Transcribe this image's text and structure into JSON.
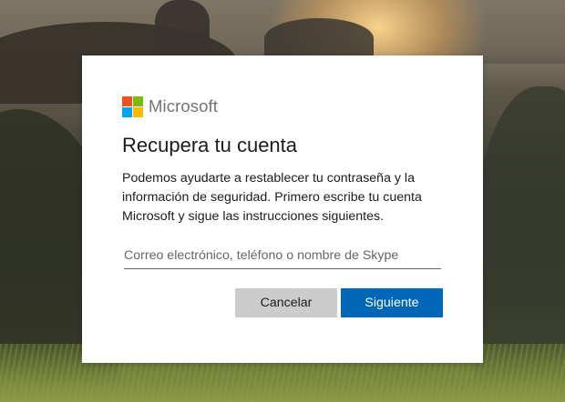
{
  "brand": {
    "name": "Microsoft",
    "logo_colors": [
      "#f25022",
      "#7fba00",
      "#00a4ef",
      "#ffb900"
    ]
  },
  "dialog": {
    "title": "Recupera tu cuenta",
    "description": "Podemos ayudarte a restablecer tu contraseña y la información de seguridad. Primero escribe tu cuenta Microsoft y sigue las instrucciones siguientes.",
    "input": {
      "value": "",
      "placeholder": "Correo electrónico, teléfono o nombre de Skype"
    },
    "buttons": {
      "cancel_label": "Cancelar",
      "next_label": "Siguiente"
    }
  },
  "colors": {
    "accent": "#0067b8",
    "secondary_button": "#cccccc",
    "card_background": "#ffffff"
  }
}
